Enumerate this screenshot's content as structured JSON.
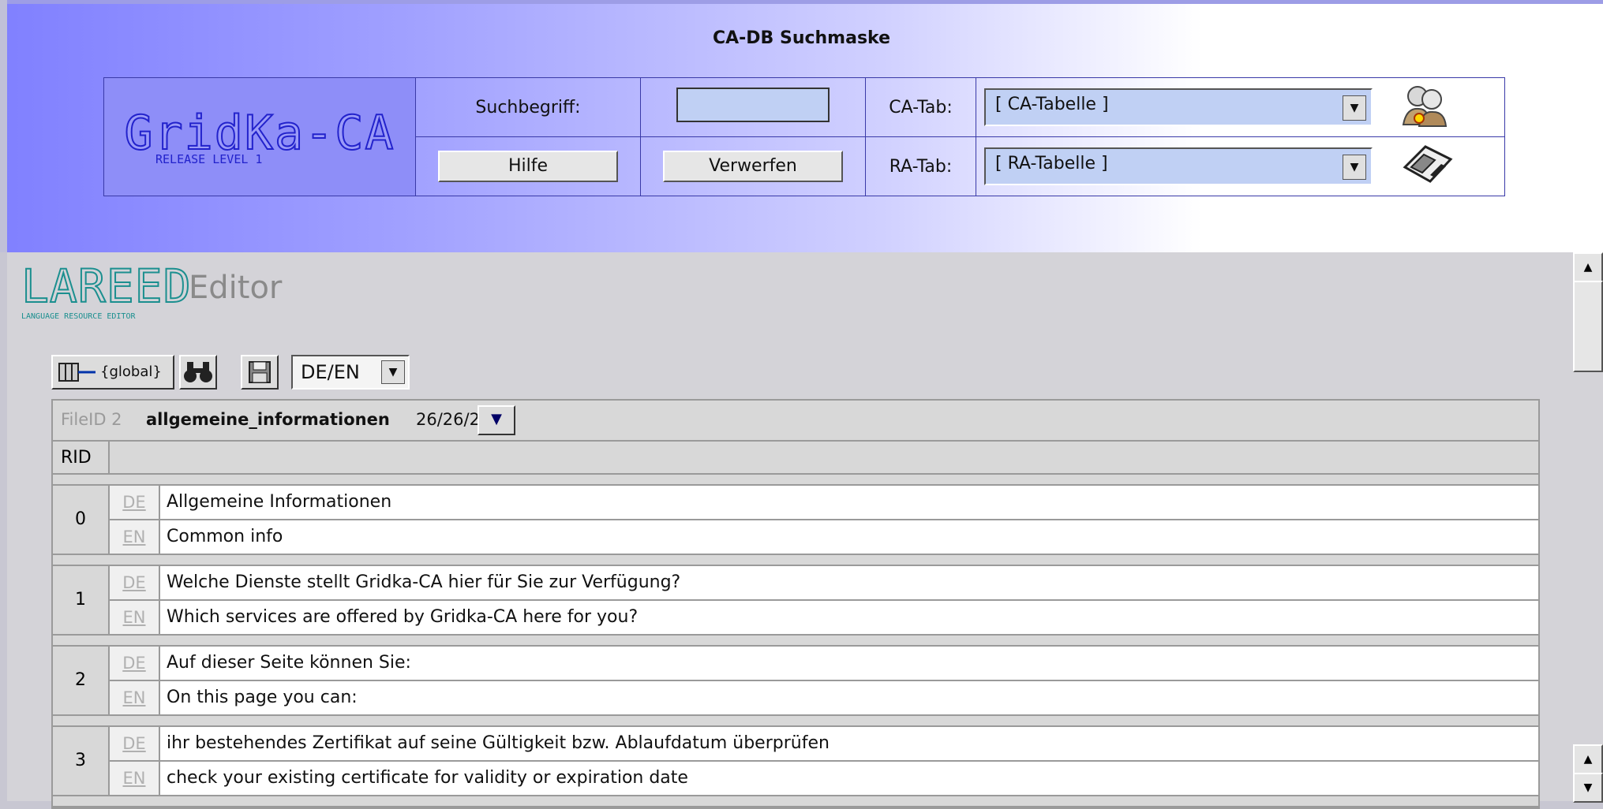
{
  "header": {
    "title": "CA-DB Suchmaske",
    "logo": "GridKa-CA",
    "logo_sub": "RELEASE LEVEL 1",
    "search_label": "Suchbegriff:",
    "help_button": "Hilfe",
    "discard_button": "Verwerfen",
    "ca_tab_label": "CA-Tab:",
    "ca_tab_value": "[  CA-Tabelle  ]",
    "ra_tab_label": "RA-Tab:",
    "ra_tab_value": "[  RA-Tabelle  ]",
    "icons": [
      "users-icon",
      "floppy-disk-icon"
    ]
  },
  "editor": {
    "logo": "LAREED",
    "logo_sub": "LANGUAGE RESOURCE EDITOR",
    "title": "Editor",
    "toolbar": {
      "scope_label": "{global}",
      "language_pair": "DE/EN",
      "icons": [
        "binoculars-icon",
        "save-icon"
      ]
    },
    "file": {
      "label": "FileID 2",
      "name": "allgemeine_informationen",
      "count": "26/26/2"
    },
    "rid_header": "RID",
    "records": [
      {
        "rid": "0",
        "de": "Allgemeine Informationen",
        "en": "Common info"
      },
      {
        "rid": "1",
        "de": "Welche Dienste stellt Gridka-CA hier für Sie zur Verfügung?",
        "en": "Which services are offered by Gridka-CA here for you?"
      },
      {
        "rid": "2",
        "de": "Auf dieser Seite können Sie:",
        "en": "On this page you can:"
      },
      {
        "rid": "3",
        "de": "ihr bestehendes Zertifikat auf seine Gültigkeit bzw. Ablaufdatum überprüfen",
        "en": "check your existing certificate for validity or expiration date"
      }
    ],
    "lang_labels": {
      "de": "DE",
      "en": "EN"
    }
  }
}
